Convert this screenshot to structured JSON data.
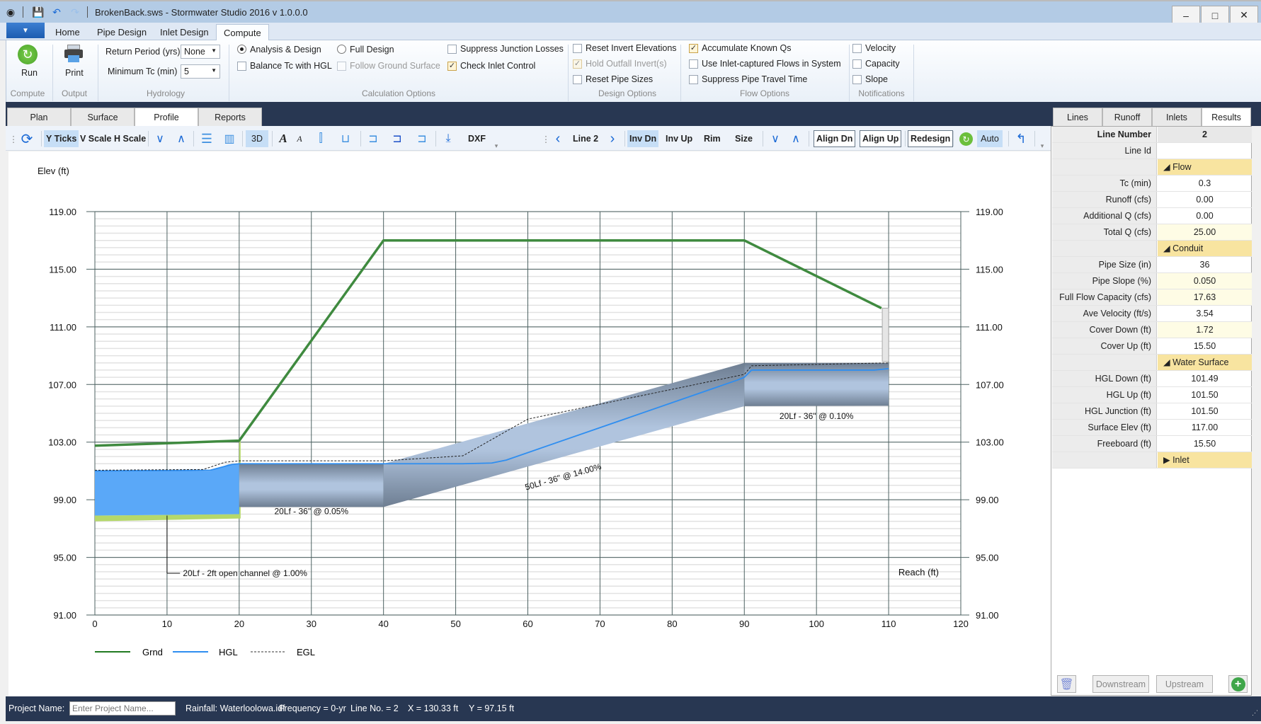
{
  "window": {
    "title": "BrokenBack.sws - Stormwater Studio 2016 v 1.0.0.0",
    "minimize": "–",
    "maximize": "□",
    "close": "✕"
  },
  "ribbon": {
    "file_menu": "▼",
    "tabs": [
      {
        "label": "Home"
      },
      {
        "label": "Pipe Design"
      },
      {
        "label": "Inlet Design"
      },
      {
        "label": "Compute",
        "active": true
      }
    ],
    "groups": {
      "compute": {
        "caption": "Compute",
        "run_label": "Run"
      },
      "output": {
        "caption": "Output",
        "print_label": "Print"
      },
      "hydrology": {
        "caption": "Hydrology",
        "return_period_label": "Return Period (yrs)",
        "return_period_value": "None",
        "min_tc_label": "Minimum Tc (min)",
        "min_tc_value": "5"
      },
      "calculation": {
        "caption": "Calculation Options",
        "analysis_design": {
          "label": "Analysis & Design",
          "selected": true
        },
        "full_design": {
          "label": "Full Design",
          "selected": false
        },
        "balance_tc": {
          "label": "Balance Tc with HGL",
          "checked": false
        },
        "follow_ground": {
          "label": "Follow Ground Surface",
          "checked": false,
          "disabled": true
        },
        "suppress_junction": {
          "label": "Suppress Junction Losses",
          "checked": false
        },
        "check_inlet": {
          "label": "Check Inlet Control",
          "checked": true
        }
      },
      "design": {
        "caption": "Design Options",
        "reset_invert": {
          "label": "Reset Invert Elevations",
          "checked": false
        },
        "hold_outfall": {
          "label": "Hold Outfall Invert(s)",
          "checked": true,
          "disabled": true
        },
        "reset_pipe": {
          "label": "Reset Pipe Sizes",
          "checked": false
        }
      },
      "flow": {
        "caption": "Flow Options",
        "accumulate": {
          "label": "Accumulate Known Qs",
          "checked": true
        },
        "inlet_captured": {
          "label": "Use Inlet-captured Flows in System",
          "checked": false
        },
        "suppress_travel": {
          "label": "Suppress Pipe Travel Time",
          "checked": false
        }
      },
      "notifications": {
        "caption": "Notifications",
        "velocity": {
          "label": "Velocity",
          "checked": false
        },
        "capacity": {
          "label": "Capacity",
          "checked": false
        },
        "slope": {
          "label": "Slope",
          "checked": false
        }
      }
    }
  },
  "view_tabs": [
    {
      "label": "Plan"
    },
    {
      "label": "Surface"
    },
    {
      "label": "Profile",
      "active": true
    },
    {
      "label": "Reports"
    }
  ],
  "toolbar": {
    "y_ticks": "Y Ticks",
    "v_scale": "V Scale",
    "h_scale": "H Scale",
    "three_d": "3D",
    "dxf": "DXF",
    "line_label": "Line 2",
    "inv_dn": "Inv Dn",
    "inv_up": "Inv Up",
    "rim": "Rim",
    "size": "Size",
    "align_dn": "Align Dn",
    "align_up": "Align Up",
    "redesign": "Redesign",
    "auto": "Auto"
  },
  "right_panel": {
    "tabs": [
      {
        "label": "Lines"
      },
      {
        "label": "Runoff"
      },
      {
        "label": "Inlets"
      },
      {
        "label": "Results",
        "active": true
      }
    ],
    "rows": [
      {
        "key": "Line Number",
        "value": "2",
        "type": "head"
      },
      {
        "key": "Line Id",
        "value": ""
      },
      {
        "key": "",
        "value": "◢ Flow",
        "type": "cat"
      },
      {
        "key": "Tc (min)",
        "value": "0.3"
      },
      {
        "key": "Runoff (cfs)",
        "value": "0.00"
      },
      {
        "key": "Additional Q (cfs)",
        "value": "0.00"
      },
      {
        "key": "Total Q (cfs)",
        "value": "25.00",
        "hl": true
      },
      {
        "key": "",
        "value": "◢ Conduit",
        "type": "cat"
      },
      {
        "key": "Pipe Size (in)",
        "value": "36"
      },
      {
        "key": "Pipe Slope (%)",
        "value": "0.050",
        "hl": true
      },
      {
        "key": "Full Flow Capacity (cfs)",
        "value": "17.63",
        "hl": true
      },
      {
        "key": "Ave Velocity (ft/s)",
        "value": "3.54"
      },
      {
        "key": "Cover Down (ft)",
        "value": "1.72",
        "hl": true
      },
      {
        "key": "Cover Up (ft)",
        "value": "15.50"
      },
      {
        "key": "",
        "value": "◢ Water Surface",
        "type": "cat"
      },
      {
        "key": "HGL Down (ft)",
        "value": "101.49"
      },
      {
        "key": "HGL Up (ft)",
        "value": "101.50"
      },
      {
        "key": "HGL Junction (ft)",
        "value": "101.50"
      },
      {
        "key": "Surface Elev (ft)",
        "value": "117.00"
      },
      {
        "key": "Freeboard (ft)",
        "value": "15.50"
      },
      {
        "key": "",
        "value": "▶ Inlet",
        "type": "cat"
      }
    ],
    "downstream": "Downstream",
    "upstream": "Upstream"
  },
  "status_bar": {
    "project_label": "Project Name:",
    "project_placeholder": "Enter Project Name...",
    "rainfall": "Rainfall: Waterloolowa.idf",
    "frequency": "Frequency = 0-yr",
    "line_no": "Line No. = 2",
    "x_readout": "X = 130.33 ft",
    "y_readout": "Y = 97.15 ft"
  },
  "colors": {
    "ground": "#3f8a3f",
    "hgl": "#2f8ef0",
    "egl": "#222222",
    "water": "#5aa8f8",
    "channel": "#b5d86a",
    "pipe_light": "#b0c4de",
    "pipe_dark": "#6e7e92"
  },
  "chart_data": {
    "type": "line",
    "title": "",
    "xlabel": "Reach (ft)",
    "ylabel": "Elev (ft)",
    "xlim": [
      0,
      120
    ],
    "ylim": [
      91,
      119
    ],
    "x_ticks": [
      "0",
      "10",
      "20",
      "30",
      "40",
      "50",
      "60",
      "70",
      "80",
      "90",
      "100",
      "110",
      "120"
    ],
    "y_ticks": [
      "119.00",
      "115.00",
      "111.00",
      "107.00",
      "103.00",
      "99.00",
      "95.00",
      "91.00"
    ],
    "grid": true,
    "legend": {
      "placement": "bottom-left",
      "entries": [
        "Grnd",
        "HGL",
        "EGL"
      ]
    },
    "series": [
      {
        "name": "Grnd",
        "points": [
          [
            0,
            102.75
          ],
          [
            20,
            103.1
          ],
          [
            40,
            117
          ],
          [
            90,
            117
          ],
          [
            109,
            112.3
          ]
        ]
      },
      {
        "name": "HGL",
        "points": [
          [
            0,
            101.0
          ],
          [
            16,
            101.05
          ],
          [
            19,
            101.45
          ],
          [
            20,
            101.5
          ],
          [
            51,
            101.5
          ],
          [
            55,
            101.55
          ],
          [
            57,
            101.75
          ],
          [
            89,
            107.3
          ],
          [
            90,
            107.5
          ],
          [
            91,
            108.0
          ],
          [
            108,
            108.0
          ],
          [
            110,
            108.1
          ]
        ]
      },
      {
        "name": "EGL",
        "points": [
          [
            0,
            101.05
          ],
          [
            15,
            101.1
          ],
          [
            18,
            101.6
          ],
          [
            20,
            101.7
          ],
          [
            40,
            101.7
          ],
          [
            51,
            102.05
          ],
          [
            60,
            104.6
          ],
          [
            90,
            107.7
          ],
          [
            91,
            108.3
          ],
          [
            110,
            108.5
          ]
        ]
      }
    ],
    "pipes": [
      {
        "label": "20Lf - 36\" @ 0.05%",
        "x": [
          20,
          40
        ],
        "invert": [
          98.5,
          98.5
        ],
        "crown": [
          101.5,
          101.5
        ],
        "label_at": [
          30,
          98.0
        ]
      },
      {
        "label": "50Lf - 36\" @ 14.00%",
        "x": [
          40,
          90
        ],
        "invert": [
          98.5,
          105.5
        ],
        "crown": [
          101.5,
          108.5
        ],
        "label_at": [
          65,
          100.4
        ]
      },
      {
        "label": "20Lf - 36\" @ 0.10%",
        "x": [
          90,
          110
        ],
        "invert": [
          105.5,
          105.52
        ],
        "crown": [
          108.5,
          108.5
        ],
        "label_at": [
          100,
          104.6
        ]
      }
    ],
    "open_channel": {
      "label": "20Lf - 2ft open channel @ 1.00%",
      "x": [
        0,
        20
      ],
      "water_top": 101.0,
      "water_bottom": [
        97.9,
        98.0
      ],
      "bed": [
        97.5,
        97.7
      ],
      "label_at": [
        12,
        93.9
      ]
    },
    "structure": {
      "x": 110,
      "bottom": 108.6,
      "top": 112.3
    }
  }
}
